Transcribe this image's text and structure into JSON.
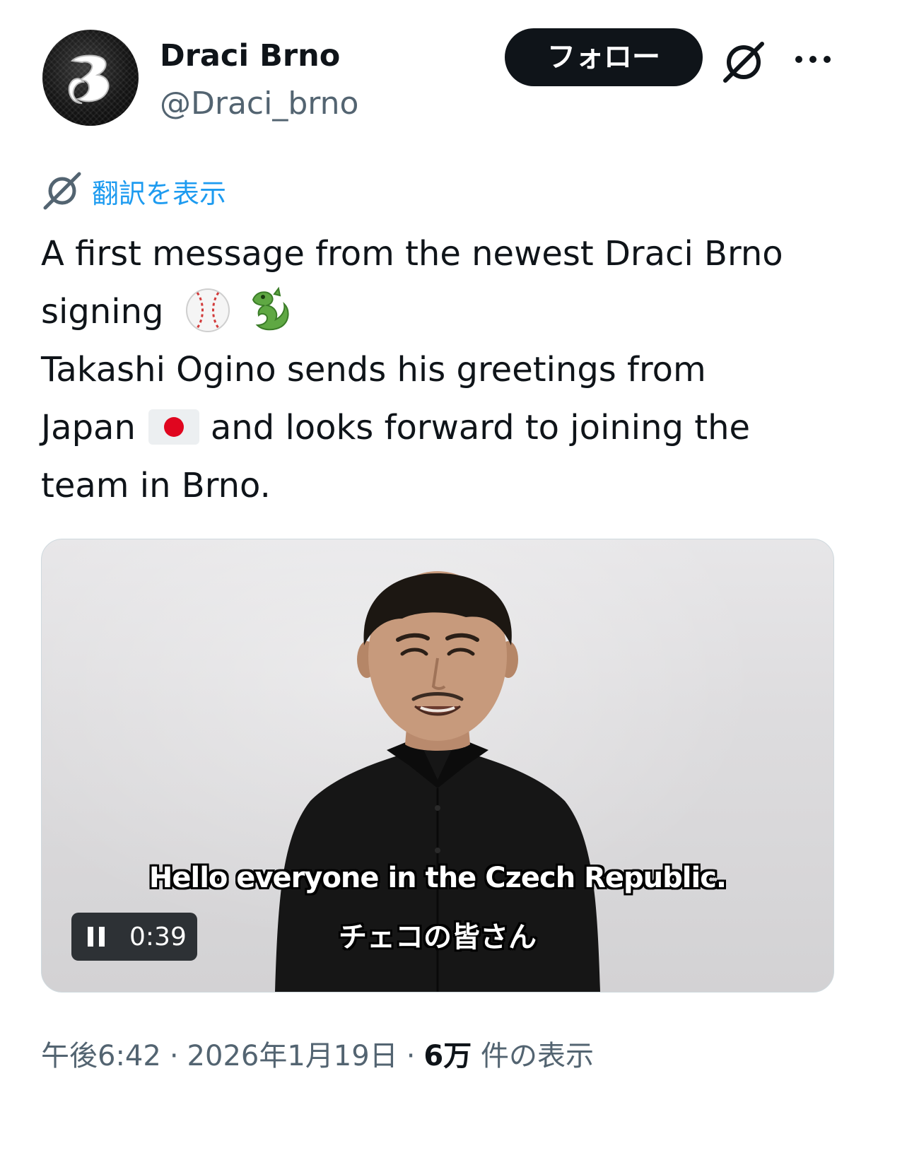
{
  "author": {
    "display_name": "Draci Brno",
    "handle": "@Draci_brno",
    "avatar_icon": "draci-brno-logo"
  },
  "actions": {
    "follow_label": "フォロー",
    "grok_icon": "grok-icon",
    "more_icon": "more-dots-icon"
  },
  "translate": {
    "label": "翻訳を表示",
    "icon": "grok-icon"
  },
  "tweet": {
    "line1": "A first message from the newest Draci Brno",
    "line2_prefix": "signing",
    "line2_emojis": [
      "baseball",
      "dragon"
    ],
    "line3": "Takashi Ogino sends his greetings from",
    "line4_prefix": "Japan",
    "line4_flag": "japan-flag",
    "line4_suffix": "and looks forward to joining the",
    "line5": "team in Brno."
  },
  "video": {
    "subtitle_en": "Hello everyone in the Czech Republic.",
    "subtitle_ja": "チェコの皆さん",
    "time": "0:39",
    "state_icon": "pause-icon"
  },
  "meta": {
    "time": "午後6:42",
    "separator": "·",
    "date": "2026年1月19日",
    "views_count": "6万",
    "views_label": "件の表示"
  },
  "colors": {
    "text_primary": "#0f1419",
    "text_secondary": "#536471",
    "link_blue": "#1d9bf0",
    "follow_bg": "#0f1419"
  }
}
